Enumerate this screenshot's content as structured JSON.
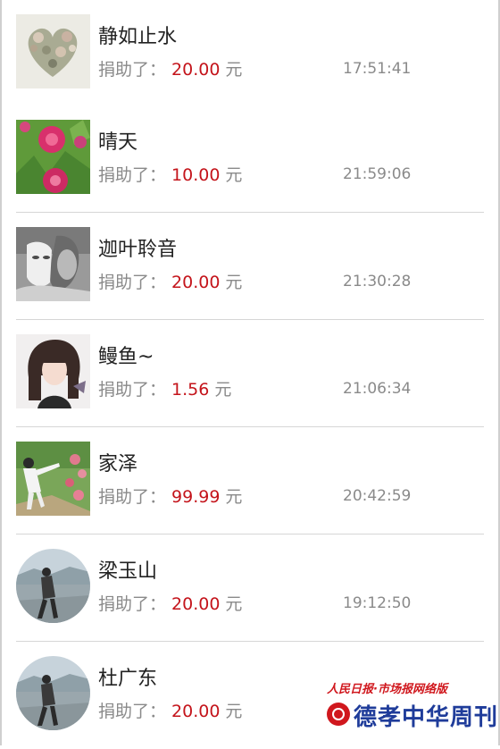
{
  "donors": [
    {
      "name": "静如止水",
      "label": "捐助了：",
      "amount": "20.00",
      "unit": "元",
      "time": "17:51:41",
      "avatar": "heart-wreath-avatar"
    },
    {
      "name": "晴天",
      "label": "捐助了：",
      "amount": "10.00",
      "unit": "元",
      "time": "21:59:06",
      "avatar": "pink-flower-avatar"
    },
    {
      "name": "迦叶聆音",
      "label": "捐助了：",
      "amount": "20.00",
      "unit": "元",
      "time": "21:30:28",
      "avatar": "masked-man-avatar"
    },
    {
      "name": "鳗鱼~",
      "label": "捐助了：",
      "amount": "1.56",
      "unit": "元",
      "time": "21:06:34",
      "avatar": "girl-portrait-avatar"
    },
    {
      "name": "家泽",
      "label": "捐助了：",
      "amount": "99.99",
      "unit": "元",
      "time": "20:42:59",
      "avatar": "garden-person-avatar"
    },
    {
      "name": "梁玉山",
      "label": "捐助了：",
      "amount": "20.00",
      "unit": "元",
      "time": "19:12:50",
      "avatar": "beach-person-avatar"
    },
    {
      "name": "杜广东",
      "label": "捐助了：",
      "amount": "20.00",
      "unit": "元",
      "time": "",
      "avatar": "beach-person-avatar"
    }
  ],
  "watermark": {
    "top_line": "人民日报·市场报网络版",
    "brand": "德孝中华周刊"
  },
  "colors": {
    "amount": "#c4141b",
    "muted": "#8a8a8a",
    "brand_red": "#d0171d",
    "brand_blue": "#1f3c9a"
  }
}
